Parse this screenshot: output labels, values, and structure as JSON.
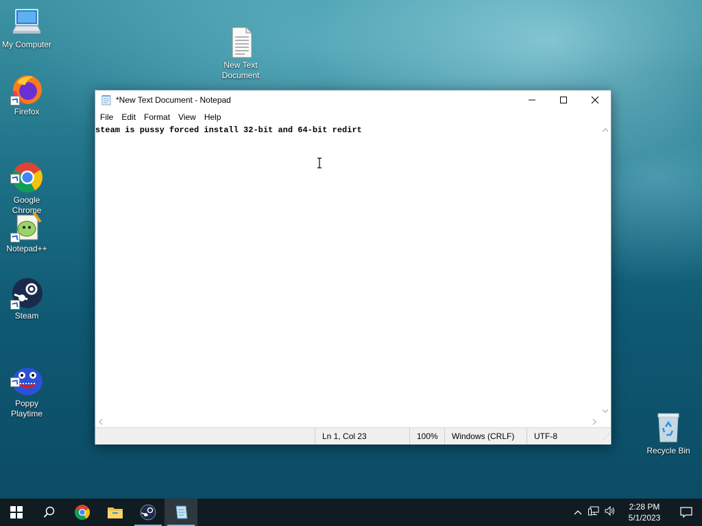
{
  "desktop": {
    "icons": [
      {
        "label": "My Computer",
        "icon": "computer-icon"
      },
      {
        "label": "New Text\nDocument",
        "icon": "text-document-icon"
      },
      {
        "label": "Firefox",
        "icon": "firefox-icon"
      },
      {
        "label": "Google\nChrome",
        "icon": "chrome-icon"
      },
      {
        "label": "Notepad++",
        "icon": "notepad-plus-plus-icon"
      },
      {
        "label": "Steam",
        "icon": "steam-icon"
      },
      {
        "label": "Poppy\nPlaytime",
        "icon": "poppy-playtime-icon"
      },
      {
        "label": "Recycle Bin",
        "icon": "recycle-bin-icon"
      }
    ]
  },
  "notepad": {
    "title": "*New Text Document - Notepad",
    "menu": [
      "File",
      "Edit",
      "Format",
      "View",
      "Help"
    ],
    "content": "steam is pussy forced install 32-bit and 64-bit redirt",
    "status": {
      "position": "Ln 1, Col 23",
      "zoom": "100%",
      "line_ending": "Windows (CRLF)",
      "encoding": "UTF-8"
    }
  },
  "taskbar": {
    "items": [
      "windows-start-icon",
      "search-icon",
      "chrome-icon",
      "file-explorer-icon",
      "steam-icon",
      "notepad-icon"
    ],
    "clock": {
      "time": "2:28 PM",
      "date": "5/1/2023"
    }
  },
  "colors": {
    "accent": "#76b9ed",
    "taskbar": "#101b22"
  }
}
